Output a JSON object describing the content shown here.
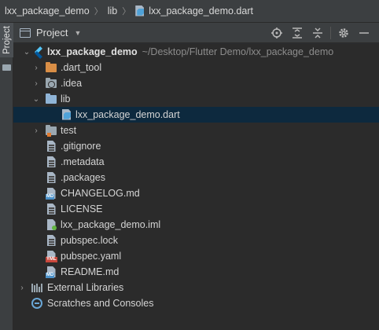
{
  "breadcrumb": {
    "project": "lxx_package_demo",
    "folder": "lib",
    "file": "lxx_package_demo.dart"
  },
  "side_strip": {
    "tab_label": "Project"
  },
  "tool_window": {
    "title": "Project",
    "tools": [
      "locate-icon",
      "expand-all-icon",
      "collapse-all-icon",
      "settings-icon",
      "hide-icon"
    ]
  },
  "tree": {
    "root": {
      "name": "lxx_package_demo",
      "path": "~/Desktop/Flutter Demo/lxx_package_demo"
    },
    "items": [
      {
        "label": ".dart_tool",
        "icon": "folder-orange"
      },
      {
        "label": ".idea",
        "icon": "folder-gear"
      },
      {
        "label": "lib",
        "icon": "folder-blue"
      },
      {
        "label": "lxx_package_demo.dart",
        "icon": "dart-file"
      },
      {
        "label": "test",
        "icon": "folder-test"
      },
      {
        "label": ".gitignore",
        "icon": "text-file"
      },
      {
        "label": ".metadata",
        "icon": "text-file"
      },
      {
        "label": ".packages",
        "icon": "text-file"
      },
      {
        "label": "CHANGELOG.md",
        "icon": "md-file"
      },
      {
        "label": "LICENSE",
        "icon": "text-file"
      },
      {
        "label": "lxx_package_demo.iml",
        "icon": "iml-file"
      },
      {
        "label": "pubspec.lock",
        "icon": "text-file"
      },
      {
        "label": "pubspec.yaml",
        "icon": "yaml-file"
      },
      {
        "label": "README.md",
        "icon": "md-file"
      },
      {
        "label": "External Libraries",
        "icon": "libraries"
      },
      {
        "label": "Scratches and Consoles",
        "icon": "scratches"
      }
    ]
  },
  "badges": {
    "md": "MD",
    "yml": "YML"
  },
  "colors": {
    "selection": "#0d293e",
    "background": "#2b2b2b",
    "header": "#3c3f41"
  }
}
